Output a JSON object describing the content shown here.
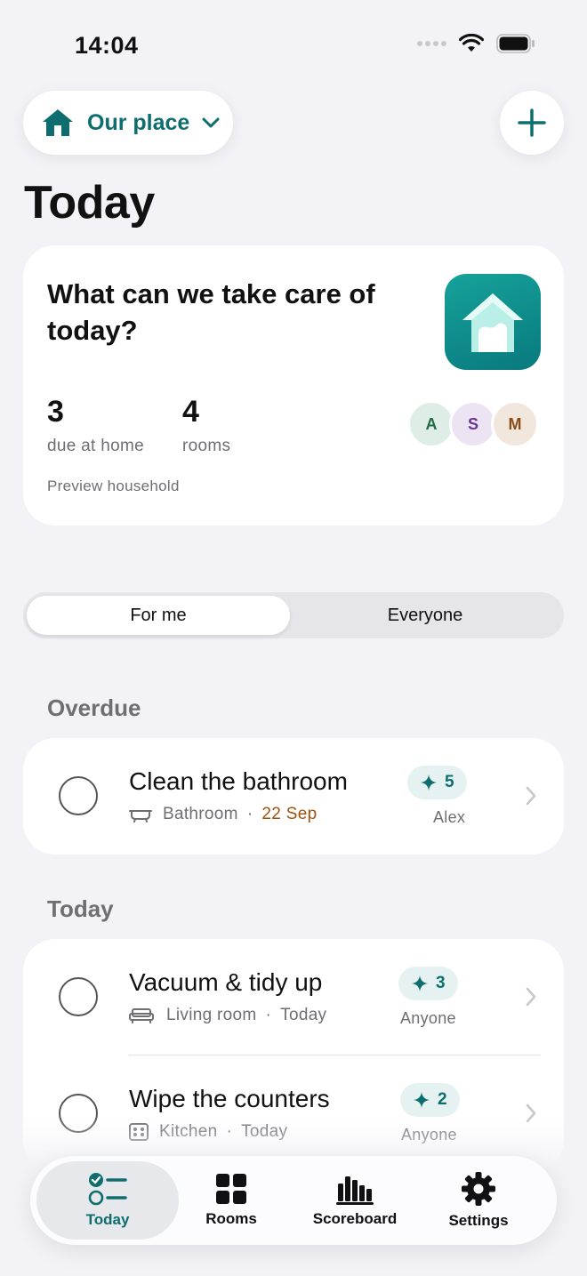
{
  "status_bar": {
    "time": "14:04"
  },
  "header": {
    "household_name": "Our place",
    "title": "Today"
  },
  "hero": {
    "question": "What can we take care of today?",
    "stats": [
      {
        "value": "3",
        "label": "due at home"
      },
      {
        "value": "4",
        "label": "rooms"
      }
    ],
    "members": [
      "A",
      "S",
      "M"
    ],
    "footer": "Preview household"
  },
  "segmented": {
    "options": [
      "For me",
      "Everyone"
    ],
    "selected": "For me"
  },
  "sections": [
    {
      "label": "Overdue",
      "tasks": [
        {
          "title": "Clean the bathroom",
          "room_icon": "bathtub-icon",
          "room": "Bathroom",
          "due": "22 Sep",
          "overdue": true,
          "points": "5",
          "assignee": "Alex"
        }
      ]
    },
    {
      "label": "Today",
      "tasks": [
        {
          "title": "Vacuum & tidy up",
          "room_icon": "sofa-icon",
          "room": "Living room",
          "due": "Today",
          "overdue": false,
          "points": "3",
          "assignee": "Anyone"
        },
        {
          "title": "Wipe the counters",
          "room_icon": "stove-icon",
          "room": "Kitchen",
          "due": "Today",
          "overdue": false,
          "points": "2",
          "assignee": "Anyone"
        }
      ]
    }
  ],
  "tab_bar": {
    "items": [
      {
        "label": "Today",
        "icon": "checklist-icon",
        "active": true
      },
      {
        "label": "Rooms",
        "icon": "grid-icon",
        "active": false
      },
      {
        "label": "Scoreboard",
        "icon": "bar-chart-icon",
        "active": false
      },
      {
        "label": "Settings",
        "icon": "gear-icon",
        "active": false
      }
    ]
  },
  "colors": {
    "accent": "#0e6d6e",
    "overdue": "#a0520c",
    "background": "#f2f2f7"
  }
}
